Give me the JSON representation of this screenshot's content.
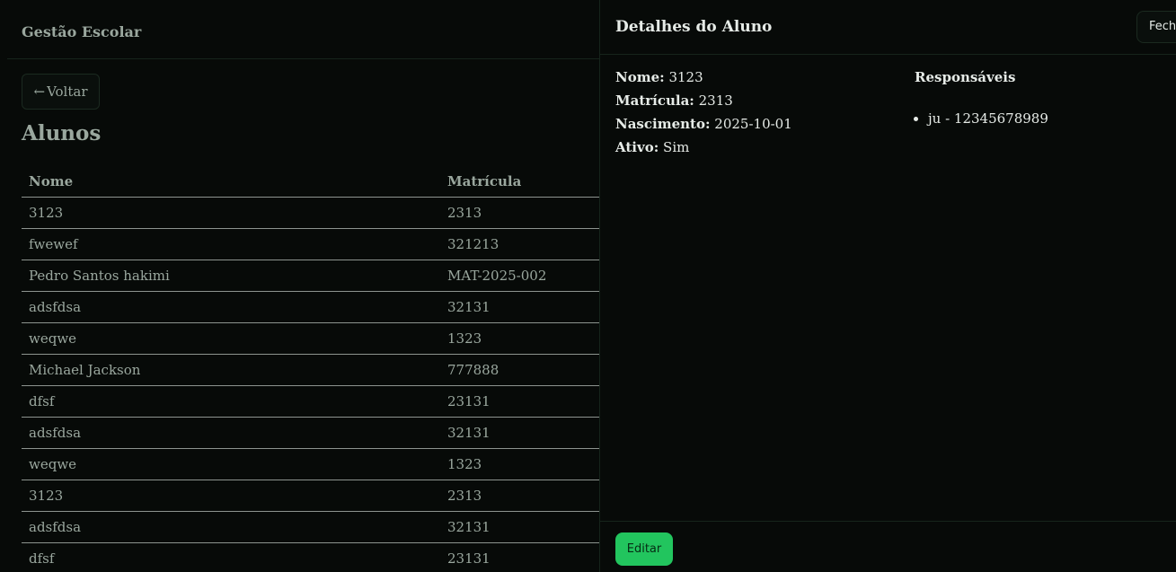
{
  "app": {
    "brand": "Gestão Escolar"
  },
  "nav": {
    "back_arrow": "←",
    "back_label": "Voltar"
  },
  "page": {
    "title": "Alunos"
  },
  "table": {
    "headers": {
      "name": "Nome",
      "registration": "Matrícula"
    },
    "rows": [
      {
        "name": "3123",
        "registration": "2313"
      },
      {
        "name": "fwewef",
        "registration": "321213"
      },
      {
        "name": "Pedro Santos hakimi",
        "registration": "MAT-2025-002"
      },
      {
        "name": "adsfdsa",
        "registration": "32131"
      },
      {
        "name": "weqwe",
        "registration": "1323"
      },
      {
        "name": "Michael Jackson",
        "registration": "777888"
      },
      {
        "name": "dfsf",
        "registration": "23131"
      },
      {
        "name": "adsfdsa",
        "registration": "32131"
      },
      {
        "name": "weqwe",
        "registration": "1323"
      },
      {
        "name": "3123",
        "registration": "2313"
      },
      {
        "name": "adsfdsa",
        "registration": "32131"
      },
      {
        "name": "dfsf",
        "registration": "23131"
      }
    ]
  },
  "details": {
    "title": "Detalhes do Aluno",
    "close_label": "Fechar",
    "fields": {
      "name_label": "Nome:",
      "name_value": "3123",
      "registration_label": "Matrícula:",
      "registration_value": "2313",
      "birth_label": "Nascimento:",
      "birth_value": "2025-10-01",
      "active_label": "Ativo:",
      "active_value": "Sim"
    },
    "guardians_title": "Responsáveis",
    "guardians": [
      "ju - 12345678989"
    ],
    "edit_label": "Editar"
  },
  "colors": {
    "accent": "#22c55e",
    "background": "#070a08",
    "muted_text": "#9aa79e",
    "text": "#e6ebe7"
  },
  "icons": {
    "back": "left-arrow-icon"
  }
}
